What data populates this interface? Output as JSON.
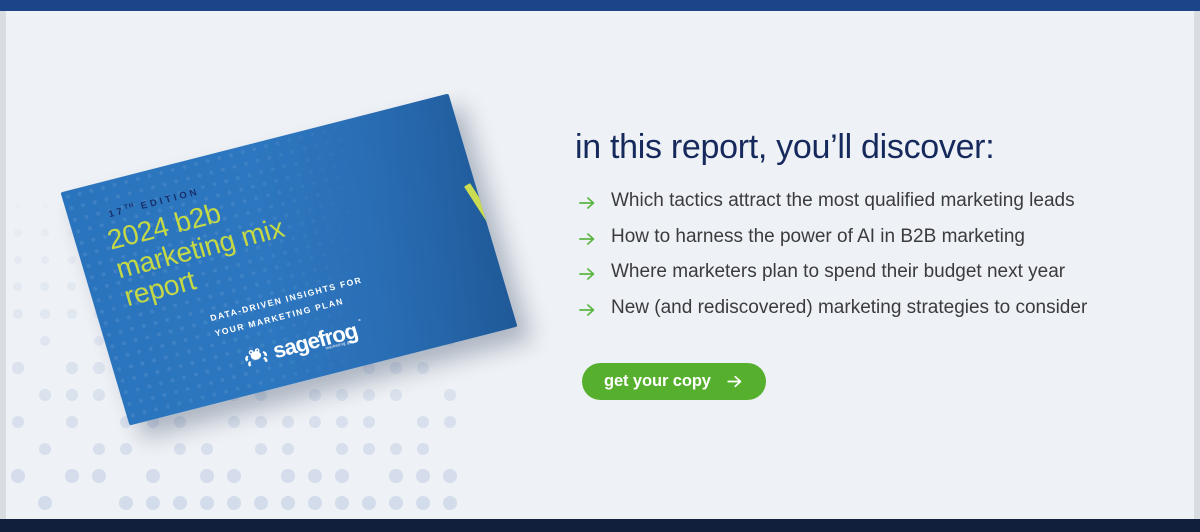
{
  "page": {
    "background_color": "#eef1f5",
    "top_bar_color": "#1b4587",
    "bottom_bar_color": "#111f3d",
    "accent_green": "#56b02d",
    "headline_navy": "#16295c",
    "dot_color": "#d3dceb"
  },
  "book": {
    "edition_prefix": "17",
    "edition_sup": "TH",
    "edition_suffix": " EDITION",
    "title": "2024 b2b\nmarketing mix\nreport",
    "subtitle": "DATA-DRIVEN INSIGHTS FOR\nYOUR MARKETING PLAN",
    "logo_word": "sagefrog",
    "logo_tagline": "marketing group",
    "logo_trademark": "°",
    "cover_color": "#2a74bd",
    "title_color": "#c5d945",
    "edition_color": "#17306b",
    "frog_icon": "frog-icon"
  },
  "content": {
    "headline": "in this report, you’ll discover:",
    "bullets": [
      {
        "arrow_icon": "arrow-right-icon",
        "text": "Which tactics attract the most qualified marketing leads"
      },
      {
        "arrow_icon": "arrow-right-icon",
        "text": "How to harness the power of AI in B2B marketing"
      },
      {
        "arrow_icon": "arrow-right-icon",
        "text": "Where marketers plan to spend their budget next year"
      },
      {
        "arrow_icon": "arrow-right-icon",
        "text": "New (and rediscovered) marketing strategies to consider"
      }
    ],
    "cta": {
      "label": "get your copy",
      "arrow_icon": "arrow-right-icon",
      "background_color": "#56b02d",
      "text_color": "#ffffff"
    }
  }
}
